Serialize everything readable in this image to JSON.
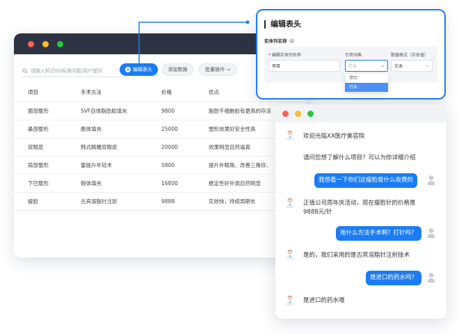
{
  "search": {
    "placeholder": "请输入知识ID/标准问题/用户提问"
  },
  "toolbar": {
    "edit_header": "编辑表头",
    "add_data": "添加数据",
    "batch_ops": "批量操作"
  },
  "table": {
    "headers": [
      "项目",
      "手术方法",
      "价格",
      "优点"
    ],
    "rows": [
      [
        "面部整形",
        "SVF自体脂肪胶填充",
        "9800",
        "脂肪干细胞胶有更高的存活"
      ],
      [
        "鼻部整形",
        "膨体填充",
        "25000",
        "塑形效果好安全性高"
      ],
      [
        "双眼皮",
        "韩式精雕双眼皮",
        "20000",
        "效果明显自然逼真"
      ],
      [
        "局部整形",
        "雷提升年轻术",
        "5800",
        "提升外眼角、改善三角纹、"
      ],
      [
        "下巴整形",
        "假体填充",
        "16800",
        "稳定性好外观自然明显"
      ],
      [
        "瘦脸",
        "古宾溶脂针注射",
        "9888",
        "见效快，持续周期长"
      ]
    ]
  },
  "editor": {
    "title": "编辑表头",
    "subtitle": "实体列名称",
    "col_name_label": "* 编辑实体列名称",
    "col_name_value": "项目",
    "dict_label": "引用词典",
    "dict_value": "行业",
    "format_label": "数据格式（实体值）",
    "format_value": "文本",
    "dropdown_options": [
      "学历",
      "行业"
    ],
    "dropdown_selected": "行业"
  },
  "chat": {
    "messages": [
      {
        "from": "bot",
        "text": "欢迎光临XX医疗美容院"
      },
      {
        "from": "bot",
        "text": "请问您想了解什么项目？可以为你详细介绍"
      },
      {
        "from": "user",
        "text": "我想看一下你们这瘦脸是什么收费的"
      },
      {
        "from": "bot",
        "text": "正值公司周年庆活动，现在瘦脸针的价格是9888元/针"
      },
      {
        "from": "user",
        "text": "用什么方法手术啊？打针吗？"
      },
      {
        "from": "bot",
        "text": "是的，我们采用的是古宾溶脂针注射技术"
      },
      {
        "from": "user",
        "text": "是进口的药水吗？"
      },
      {
        "from": "bot",
        "text": "是进口的药水哦"
      }
    ]
  },
  "colors": {
    "accent": "#1b7cf5",
    "titlebar": "#2e3343"
  },
  "icons": [
    "search-icon",
    "plus-circle-icon",
    "chevron-down-icon",
    "info-icon",
    "bot-avatar-icon",
    "user-avatar-icon"
  ]
}
